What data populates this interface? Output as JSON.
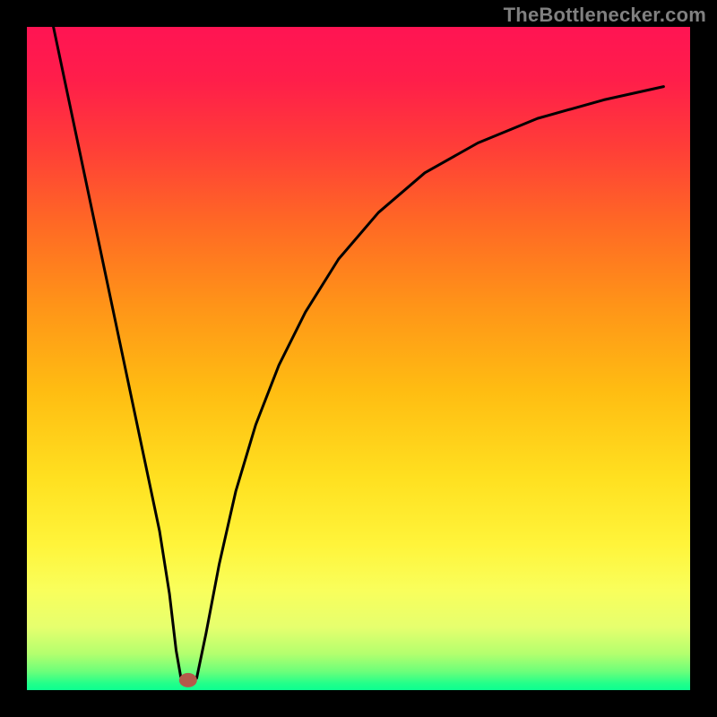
{
  "attribution": "TheBottlenecker.com",
  "gradient": {
    "stops": [
      {
        "offset": 0.0,
        "color": "#ff1453"
      },
      {
        "offset": 0.08,
        "color": "#ff1e4a"
      },
      {
        "offset": 0.18,
        "color": "#ff3d38"
      },
      {
        "offset": 0.3,
        "color": "#ff6a24"
      },
      {
        "offset": 0.42,
        "color": "#ff9418"
      },
      {
        "offset": 0.55,
        "color": "#ffbd12"
      },
      {
        "offset": 0.68,
        "color": "#ffe020"
      },
      {
        "offset": 0.78,
        "color": "#fff43a"
      },
      {
        "offset": 0.85,
        "color": "#f9ff5c"
      },
      {
        "offset": 0.905,
        "color": "#e6ff6e"
      },
      {
        "offset": 0.945,
        "color": "#b4ff6e"
      },
      {
        "offset": 0.972,
        "color": "#6cff7a"
      },
      {
        "offset": 0.99,
        "color": "#22ff8a"
      },
      {
        "offset": 1.0,
        "color": "#0cff90"
      }
    ]
  },
  "black_border_px": 30,
  "marker": {
    "x_frac": 0.243,
    "y_frac": 0.985,
    "rx": 10,
    "ry": 8,
    "color": "#b45a4a"
  },
  "chart_data": {
    "type": "line",
    "title": "",
    "xlabel": "",
    "ylabel": "",
    "xlim": [
      0,
      1
    ],
    "ylim": [
      0,
      1
    ],
    "y_axis_inverted_note": "y=0 is green (good), y=1 is red (bad); plotted with y increasing downward visually",
    "series": [
      {
        "name": "left-descent",
        "x": [
          0.04,
          0.06,
          0.08,
          0.1,
          0.12,
          0.14,
          0.16,
          0.18,
          0.2,
          0.215,
          0.225,
          0.232
        ],
        "values": [
          1.0,
          0.905,
          0.81,
          0.715,
          0.62,
          0.525,
          0.43,
          0.335,
          0.24,
          0.145,
          0.06,
          0.02
        ]
      },
      {
        "name": "valley-floor",
        "x": [
          0.232,
          0.24,
          0.248,
          0.256
        ],
        "values": [
          0.02,
          0.012,
          0.012,
          0.018
        ]
      },
      {
        "name": "right-ascent",
        "x": [
          0.256,
          0.27,
          0.29,
          0.315,
          0.345,
          0.38,
          0.42,
          0.47,
          0.53,
          0.6,
          0.68,
          0.77,
          0.87,
          0.96
        ],
        "values": [
          0.018,
          0.085,
          0.19,
          0.3,
          0.4,
          0.49,
          0.57,
          0.65,
          0.72,
          0.78,
          0.825,
          0.862,
          0.89,
          0.91
        ]
      }
    ],
    "marker_point": {
      "x": 0.243,
      "y": 0.015
    }
  }
}
